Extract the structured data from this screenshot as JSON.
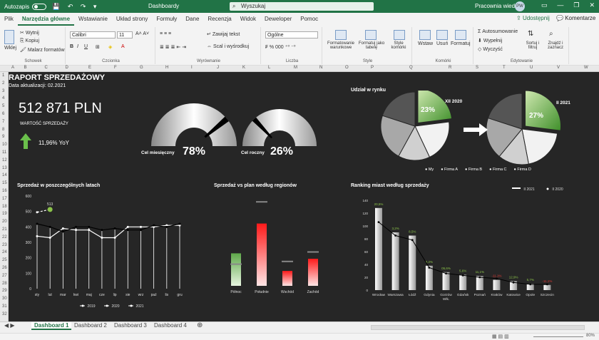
{
  "titlebar": {
    "autosave": "Autozapis",
    "document": "Dashboardy",
    "search": "Wyszukaj",
    "account": "Pracownia wiedzy",
    "initials": "PW"
  },
  "tabs": [
    "Plik",
    "Narzędzia główne",
    "Wstawianie",
    "Układ strony",
    "Formuły",
    "Dane",
    "Recenzja",
    "Widok",
    "Deweloper",
    "Pomoc"
  ],
  "share": "Udostępnij",
  "comments": "Komentarze",
  "ribbon": {
    "paste": "Wklej",
    "cut": "Wytnij",
    "copy": "Kopiuj",
    "painter": "Malarz formatów",
    "clipboard": "Schowek",
    "font": "Calibri",
    "size": "11",
    "font_group": "Czcionka",
    "wrap": "Zawijaj tekst",
    "merge": "Scal i wyśrodkuj",
    "align_group": "Wyrównanie",
    "numfmt": "Ogólne",
    "number_group": "Liczba",
    "cond": "Formatowanie warunkowe",
    "astable": "Formatuj jako tabelę",
    "styles": "Style komórki",
    "style_group": "Style",
    "insert": "Wstaw",
    "delete": "Usuń",
    "format": "Formatuj",
    "cells_group": "Komórki",
    "autosum": "Autosumowanie",
    "fill": "Wypełnij",
    "clear": "Wyczyść",
    "sort": "Sortuj i filtruj",
    "find": "Znajdź i zaznacz",
    "edit_group": "Edytowanie"
  },
  "columns": [
    "A",
    "B",
    "C",
    "D",
    "E",
    "F",
    "G",
    "H",
    "I",
    "J",
    "K",
    "L",
    "M",
    "N",
    "O",
    "P",
    "Q",
    "R",
    "S",
    "T",
    "U",
    "V",
    "W"
  ],
  "rows": [
    "1",
    "2",
    "3",
    "4",
    "5",
    "6",
    "7",
    "8",
    "9",
    "10",
    "11",
    "12",
    "13",
    "14",
    "15",
    "16",
    "17",
    "18",
    "19",
    "20",
    "21",
    "22",
    "23",
    "24",
    "25",
    "26",
    "27",
    "28",
    "29",
    "30",
    "31",
    "32"
  ],
  "report": {
    "title": "RAPORT SPRZEDAŻOWY",
    "date": "Data aktualizacji: 02.2021",
    "total": "512 871 PLN",
    "total_label": "WARTOŚĆ SPRZEDAŻY",
    "yoy": "11,96% YoY"
  },
  "gauges": [
    {
      "label": "Cel miesięczny",
      "value": "78%",
      "fraction": 0.78
    },
    {
      "label": "Cel roczny",
      "value": "26%",
      "fraction": 0.26
    }
  ],
  "share_title": "Udział w rynku",
  "pies": [
    {
      "label": "XII 2020",
      "pct": "23%",
      "slices": [
        23,
        20,
        15,
        22,
        20
      ]
    },
    {
      "label": "II 2021",
      "pct": "27%",
      "slices": [
        27,
        20,
        14,
        19,
        20
      ]
    }
  ],
  "pie_legend": [
    "My",
    "Firma A",
    "Firma B",
    "Firma C",
    "Firma D"
  ],
  "chart_data": [
    {
      "type": "line",
      "title": "Sprzedaż w poszczególnych latach",
      "categories": [
        "sty",
        "lut",
        "mar",
        "kwi",
        "maj",
        "cze",
        "lip",
        "sie",
        "wrz",
        "paź",
        "lis",
        "gru"
      ],
      "ylim": [
        0,
        600
      ],
      "yticks": [
        "0",
        "100",
        "200",
        "300",
        "400",
        "500",
        "600"
      ],
      "annotation": "513",
      "series": [
        {
          "name": "2019",
          "values": [
            340,
            330,
            390,
            380,
            380,
            330,
            330,
            400,
            400,
            400,
            410,
            410
          ]
        },
        {
          "name": "2020",
          "values": [
            420,
            400,
            370,
            400,
            400,
            380,
            390,
            380,
            380,
            410,
            400,
            420
          ]
        },
        {
          "name": "2021",
          "values": [
            495,
            513,
            null,
            null,
            null,
            null,
            null,
            null,
            null,
            null,
            null,
            null
          ]
        }
      ],
      "series_style": [
        {
          "color": "#ffffff",
          "dash": "none"
        },
        {
          "color": "#000000",
          "dash": "none"
        },
        {
          "color": "#ffffff",
          "dash": "3,2"
        }
      ]
    },
    {
      "type": "bar",
      "title": "Sprzedaż vs plan według regionów",
      "categories": [
        "Północ",
        "Południe",
        "Wschód",
        "Zachód"
      ],
      "series": [
        {
          "values": [
            120,
            230,
            55,
            100
          ]
        },
        {
          "values": [
            80,
            310,
            90,
            125
          ]
        }
      ]
    },
    {
      "type": "bar",
      "title": "Ranking miast według sprzedaży",
      "categories": [
        "Wrocław",
        "Warszawa",
        "Łódź",
        "Gdynia",
        "Gorzów Wlk.",
        "Gdańsk",
        "Poznań",
        "Kraków",
        "Katowice",
        "Opole",
        "Szczecin"
      ],
      "legend": [
        "II 2021",
        "II 2020"
      ],
      "yticks": [
        "0",
        "20",
        "40",
        "60",
        "80",
        "100",
        "120",
        "140"
      ],
      "ylim": [
        0,
        140
      ],
      "series": [
        {
          "name": "II 2021",
          "values": [
            128,
            90,
            85,
            38,
            28,
            24,
            22,
            16,
            14,
            10,
            8
          ]
        },
        {
          "name": "II 2020",
          "values": [
            106,
            85,
            78,
            35,
            26,
            23,
            20,
            18,
            12,
            9,
            9
          ]
        }
      ],
      "labels": [
        "20,5%",
        "3,2%",
        "8,5%",
        "8,2%",
        "05,6%",
        "5,6%",
        "11,1%",
        "-11,1%",
        "12,9%",
        "5,7%",
        "-11,1%"
      ],
      "label_colors": [
        "#8bc34a",
        "#8bc34a",
        "#8bc34a",
        "#8bc34a",
        "#8bc34a",
        "#8bc34a",
        "#8bc34a",
        "#e53935",
        "#8bc34a",
        "#8bc34a",
        "#e53935"
      ]
    }
  ],
  "sheets": [
    "Dashboard 1",
    "Dashboard 2",
    "Dashboard 3",
    "Dashboard 4"
  ],
  "zoom": "80%",
  "colors": {
    "accent": "#217346",
    "green": "#6abf4b",
    "red": "#e53935"
  }
}
